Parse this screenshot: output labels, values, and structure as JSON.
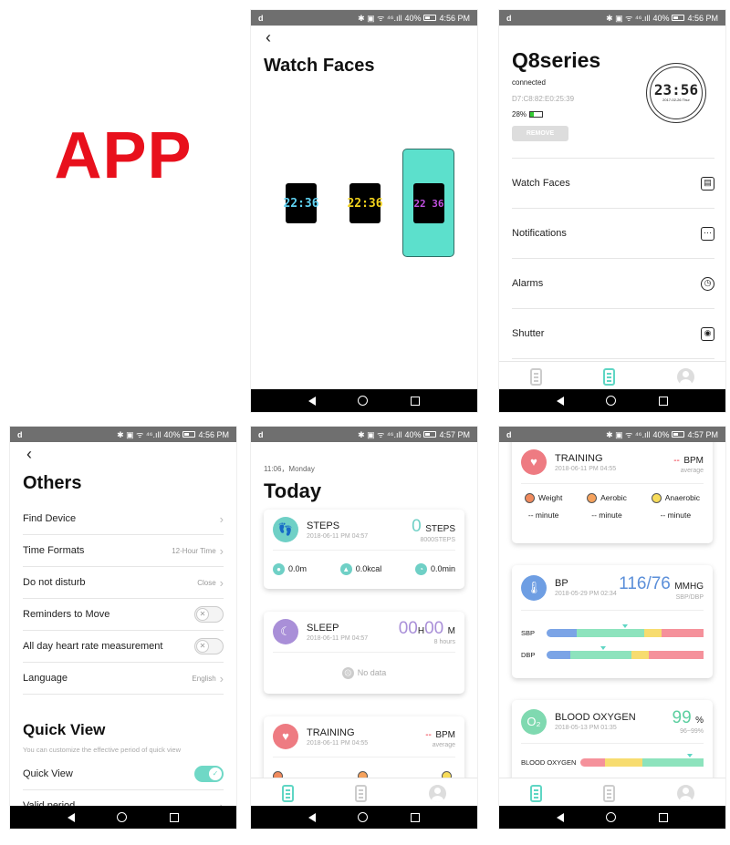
{
  "app_label": "APP",
  "status_bars": [
    {
      "carrier_icon": "d",
      "network": "✱ ▣ ᯤ ⁴⁶.ıll",
      "battery": "40%",
      "time": "4:56 PM"
    },
    {
      "carrier_icon": "d",
      "network": "✱ ▣ ᯤ ⁴⁶.ıll",
      "battery": "40%",
      "time": "4:56 PM"
    },
    {
      "carrier_icon": "d",
      "network": "✱ ▣ ᯤ ⁴⁶.ıll",
      "battery": "40%",
      "time": "4:56 PM"
    },
    {
      "carrier_icon": "d",
      "network": "✱ ▣ ᯤ ⁴⁶.ıll",
      "battery": "40%",
      "time": "4:57 PM"
    },
    {
      "carrier_icon": "d",
      "network": "✱ ▣ ᯤ ⁴⁶.ıll",
      "battery": "40%",
      "time": "4:57 PM"
    }
  ],
  "watch_faces": {
    "title": "Watch Faces",
    "faces": [
      {
        "time": "22:36",
        "color": "#5fd0f0",
        "selected": false
      },
      {
        "time": "22:36",
        "color": "#f2d21c",
        "selected": false
      },
      {
        "time": "22 36",
        "color": "#c050e0",
        "selected": true
      }
    ],
    "selected_bg": "#5ce0cc"
  },
  "device": {
    "name": "Q8series",
    "status": "connected",
    "mac": "D7:C8:82:E0:25:39",
    "battery": "28%",
    "battery_level": 0.28,
    "remove_label": "REMOVE",
    "watch_time": "23:56",
    "watch_date": "2017-02-26",
    "watch_day": "Thur",
    "menu": [
      {
        "label": "Watch Faces",
        "icon": "watch-face-icon"
      },
      {
        "label": "Notifications",
        "icon": "chat-icon"
      },
      {
        "label": "Alarms",
        "icon": "clock-icon"
      },
      {
        "label": "Shutter",
        "icon": "camera-icon"
      }
    ]
  },
  "others": {
    "title": "Others",
    "items": [
      {
        "label": "Find Device",
        "value": ""
      },
      {
        "label": "Time Formats",
        "value": "12-Hour Time"
      },
      {
        "label": "Do not disturb",
        "value": "Close"
      },
      {
        "label": "Reminders to Move",
        "toggle": false
      },
      {
        "label": "All day heart rate measurement",
        "toggle": false
      },
      {
        "label": "Language",
        "value": "English"
      }
    ],
    "quick_view": {
      "title": "Quick View",
      "subtitle": "You can customize the effective period of quick view",
      "toggle_label": "Quick View",
      "toggle": true,
      "valid_period_label": "Valid period"
    }
  },
  "today": {
    "date": "11:06，Monday",
    "title": "Today",
    "steps": {
      "title": "STEPS",
      "date": "2018-06-11 PM 04:57",
      "value": "0",
      "unit": "STEPS",
      "goal": "8000STEPS",
      "distance": "0.0m",
      "calories": "0.0kcal",
      "duration": "0.0min"
    },
    "sleep": {
      "title": "SLEEP",
      "date": "2018-06-11 PM 04:57",
      "hours": "00",
      "h_unit": "H",
      "minutes": "00",
      "m_unit": "M",
      "goal": "8 hours",
      "empty": "No data"
    },
    "training": {
      "title": "TRAINING",
      "date": "2018-06-11 PM 04:55",
      "value": "--",
      "unit": "BPM",
      "sub": "average"
    }
  },
  "health": {
    "training": {
      "title": "TRAINING",
      "date": "2018-06-11 PM 04:55",
      "value": "--",
      "unit": "BPM",
      "sub": "average",
      "types": [
        {
          "label": "Weight",
          "value": "-- minute",
          "color": "#f08a5d"
        },
        {
          "label": "Aerobic",
          "value": "-- minute",
          "color": "#f5a25d"
        },
        {
          "label": "Anaerobic",
          "value": "-- minute",
          "color": "#f7dc5a"
        }
      ]
    },
    "bp": {
      "title": "BP",
      "date": "2018-05-29 PM 02:34",
      "value": "116/76",
      "unit": "MMHG",
      "sub": "SBP/DBP",
      "bars": [
        {
          "label": "SBP",
          "level": 0.5,
          "segments": [
            {
              "color": "#7ba4e6",
              "to": 0.19
            },
            {
              "color": "#8de3bd",
              "to": 0.62
            },
            {
              "color": "#f7dc6f",
              "to": 0.73
            },
            {
              "color": "#f5919b",
              "to": 1
            }
          ]
        },
        {
          "label": "DBP",
          "level": 0.36,
          "segments": [
            {
              "color": "#7ba4e6",
              "to": 0.15
            },
            {
              "color": "#8de3bd",
              "to": 0.54
            },
            {
              "color": "#f7dc6f",
              "to": 0.65
            },
            {
              "color": "#f5919b",
              "to": 1
            }
          ]
        }
      ]
    },
    "oxygen": {
      "title": "BLOOD OXYGEN",
      "date": "2018-05-13 PM 01:35",
      "value": "99",
      "unit": "%",
      "sub": "96~99%",
      "bar": {
        "label": "BLOOD OXYGEN",
        "level": 0.89,
        "segments": [
          {
            "color": "#f5919b",
            "to": 0.2
          },
          {
            "color": "#f7dc6f",
            "to": 0.5
          },
          {
            "color": "#8de3bd",
            "to": 1
          }
        ]
      }
    }
  },
  "colors": {
    "accent": "#5fd6c4",
    "steps": "#6fd0c6",
    "sleep": "#a98fd8",
    "training": "#ee7b82",
    "bp": "#6e9ee3",
    "oxygen": "#7fd9b0",
    "app_label": "#e8101c"
  }
}
